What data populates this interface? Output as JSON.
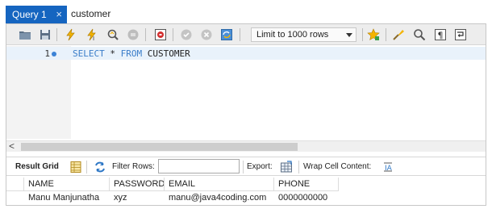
{
  "tabs": [
    {
      "label": "Query 1",
      "close": "×",
      "active": true
    },
    {
      "label": "customer",
      "active": false
    }
  ],
  "toolbar": {
    "limit_select": "Limit to 1000 rows",
    "icons": [
      "open-folder-icon",
      "save-icon",
      "execute-icon",
      "execute-current-icon",
      "explain-icon",
      "stop-icon",
      "toggle-error-icon",
      "commit-icon",
      "rollback-icon",
      "autocommit-icon",
      "bookmark-icon",
      "beautify-icon",
      "find-icon",
      "invisible-chars-icon",
      "wrap-icon"
    ]
  },
  "editor": {
    "line_number": "1",
    "kw_select": "SELECT",
    "star": " * ",
    "kw_from": "FROM",
    "table": " CUSTOMER"
  },
  "scroll": {
    "left_arrow": "<"
  },
  "result_bar": {
    "result_grid": "Result Grid",
    "filter_rows": "Filter Rows:",
    "filter_value": "",
    "export": "Export:",
    "wrap": "Wrap Cell Content:"
  },
  "grid": {
    "columns": [
      "NAME",
      "PASSWORD",
      "EMAIL",
      "PHONE"
    ],
    "rows": [
      [
        "Manu Manjunatha",
        "xyz",
        "manu@java4coding.com",
        "0000000000"
      ]
    ]
  },
  "colors": {
    "tab_active": "#1565c0",
    "keyword": "#3a7dc9",
    "current_line": "#e9f2fb",
    "toolbar_bg": "#ededed"
  }
}
